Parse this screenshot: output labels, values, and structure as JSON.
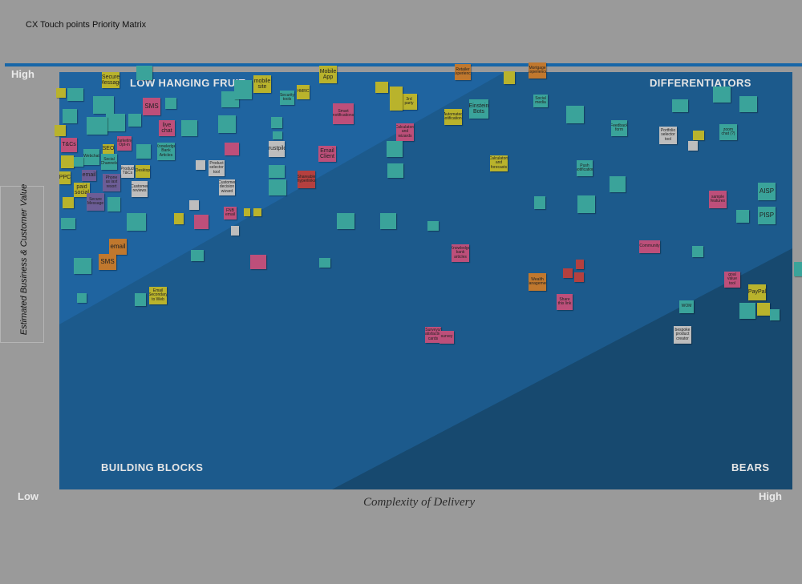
{
  "board": {
    "title": "CX Touch points Priority Matrix",
    "y_axis": {
      "label": "Estimated Business & Customer Value",
      "low": "Low",
      "high": "High"
    },
    "x_axis": {
      "label": "Complexity of Delivery",
      "high": "High"
    }
  },
  "quadrants": {
    "top_left": "LOW HANGING FRUIT",
    "top_right": "DIFFERENTIATORS",
    "bottom_left": "BUILDING BLOCKS",
    "bottom_right": "BEARS"
  },
  "colors": {
    "backdrop": "#9a9a9a",
    "matrix_base": "#1c5a8c",
    "matrix_light": "#1f64a0",
    "matrix_dark": "#17496f",
    "accent_bar": "#1766a8"
  },
  "notes": [
    {
      "label": "Secure Message",
      "color": "y"
    },
    {
      "label": "Mobile App",
      "color": "y"
    },
    {
      "label": "mobile site",
      "color": "y"
    },
    {
      "label": "SMS",
      "color": "p"
    },
    {
      "label": "live chat",
      "color": "p"
    },
    {
      "label": "Einstein Bots",
      "color": "g"
    },
    {
      "label": "Email Client",
      "color": "p"
    },
    {
      "label": "AISP",
      "color": "g"
    },
    {
      "label": "PISP",
      "color": "g"
    },
    {
      "label": "PayPal",
      "color": "y"
    },
    {
      "label": "email",
      "color": "o"
    },
    {
      "label": "SMS",
      "color": "o"
    },
    {
      "label": "T&Cs",
      "color": "p"
    },
    {
      "label": "PPC",
      "color": "y"
    },
    {
      "label": "paid social",
      "color": "y"
    },
    {
      "label": "email",
      "color": "pu"
    },
    {
      "label": "SEO",
      "color": "y"
    },
    {
      "label": "Webchat",
      "color": "g"
    },
    {
      "label": "Social Channels",
      "color": "g"
    },
    {
      "label": "Secure Message",
      "color": "pu"
    },
    {
      "label": "Product T&Cs",
      "color": "w"
    },
    {
      "label": "Customer reviews",
      "color": "w"
    },
    {
      "label": "Desktop",
      "color": "y"
    },
    {
      "label": "Trustpilot",
      "color": "w"
    },
    {
      "label": "Product selector tool",
      "color": "w"
    },
    {
      "label": "Customer decision wizard",
      "color": "w"
    },
    {
      "label": "Community",
      "color": "p"
    },
    {
      "label": "Share this link",
      "color": "p"
    },
    {
      "label": "WOM",
      "color": "g"
    },
    {
      "label": "bespoke product creator",
      "color": "w"
    },
    {
      "label": "Portfolio selector tool",
      "color": "w"
    },
    {
      "label": "zoom chat (?)",
      "color": "g"
    },
    {
      "label": "goal value tool",
      "color": "p"
    },
    {
      "label": "Social media",
      "color": "g"
    },
    {
      "label": "Calculators and forecasts",
      "color": "y"
    },
    {
      "label": "Knowledge bank articles",
      "color": "p"
    },
    {
      "label": "Surveys/ satisfaction cards",
      "color": "p"
    },
    {
      "label": "survey",
      "color": "p"
    },
    {
      "label": "Shareable hyperlinks",
      "color": "r"
    },
    {
      "label": "Smart notifications",
      "color": "p"
    },
    {
      "label": "Automated notifications",
      "color": "y"
    },
    {
      "label": "sample features",
      "color": "p"
    },
    {
      "label": "Feedback form",
      "color": "g"
    },
    {
      "label": "Security tools",
      "color": "g"
    },
    {
      "label": "HMRC",
      "color": "y"
    },
    {
      "label": "Email Secondary to Web",
      "color": "y"
    },
    {
      "label": "Calculators and wizards",
      "color": "p"
    },
    {
      "label": "Wealth Management",
      "color": "o"
    },
    {
      "label": "3rd party",
      "color": "y"
    },
    {
      "label": "Marketing Opt-in",
      "color": "p"
    },
    {
      "label": "FNB email",
      "color": "p"
    },
    {
      "label": "Push notification",
      "color": "g"
    },
    {
      "label": "Knowledge Bank Articles",
      "color": "g"
    },
    {
      "label": "Retailer Experience",
      "color": "o"
    },
    {
      "label": "Mortgage Experience",
      "color": "o"
    },
    {
      "label": "Phone as last resort",
      "color": "pu"
    }
  ]
}
